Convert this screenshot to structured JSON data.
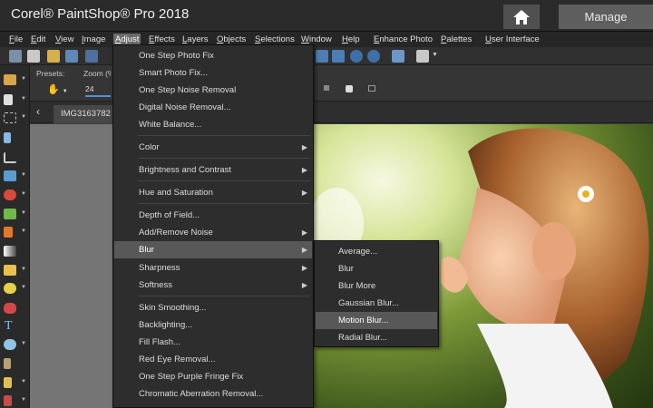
{
  "app": {
    "title": "Corel® PaintShop® Pro 2018",
    "manage_tab": "Manage",
    "home_icon": "home-icon"
  },
  "menubar": [
    "File",
    "Edit",
    "View",
    "Image",
    "Adjust",
    "Effects",
    "Layers",
    "Objects",
    "Selections",
    "Window",
    "Help",
    "Enhance Photo",
    "Palettes",
    "User Interface"
  ],
  "active_menu": "Adjust",
  "tool_options": {
    "presets_label": "Presets:",
    "zoom_label": "Zoom (%)",
    "zoom_value": "24"
  },
  "document_tab": "IMG3163782",
  "adjust_menu": [
    {
      "label": "One Step Photo Fix",
      "submenu": false
    },
    {
      "label": "Smart Photo Fix...",
      "submenu": false
    },
    {
      "label": "One Step Noise Removal",
      "submenu": false
    },
    {
      "label": "Digital Noise Removal...",
      "submenu": false
    },
    {
      "label": "White Balance...",
      "submenu": false
    },
    {
      "label": "Color",
      "submenu": true
    },
    {
      "label": "Brightness and Contrast",
      "submenu": true
    },
    {
      "label": "Hue and Saturation",
      "submenu": true
    },
    {
      "label": "Depth of Field...",
      "submenu": false
    },
    {
      "label": "Add/Remove Noise",
      "submenu": true
    },
    {
      "label": "Blur",
      "submenu": true,
      "highlighted": true
    },
    {
      "label": "Sharpness",
      "submenu": true
    },
    {
      "label": "Softness",
      "submenu": true
    },
    {
      "label": "Skin Smoothing...",
      "submenu": false
    },
    {
      "label": "Backlighting...",
      "submenu": false
    },
    {
      "label": "Fill Flash...",
      "submenu": false
    },
    {
      "label": "Red Eye Removal...",
      "submenu": false
    },
    {
      "label": "One Step Purple Fringe Fix",
      "submenu": false
    },
    {
      "label": "Chromatic Aberration Removal...",
      "submenu": false
    }
  ],
  "blur_submenu": [
    {
      "label": "Average..."
    },
    {
      "label": "Blur"
    },
    {
      "label": "Blur More"
    },
    {
      "label": "Gaussian Blur..."
    },
    {
      "label": "Motion Blur...",
      "highlighted": true
    },
    {
      "label": "Radial Blur..."
    }
  ],
  "colors": {
    "menu_bg": "#2d2d2d",
    "highlight": "#585858",
    "canvas": "#757575",
    "titlebar": "#2b2b2b"
  }
}
